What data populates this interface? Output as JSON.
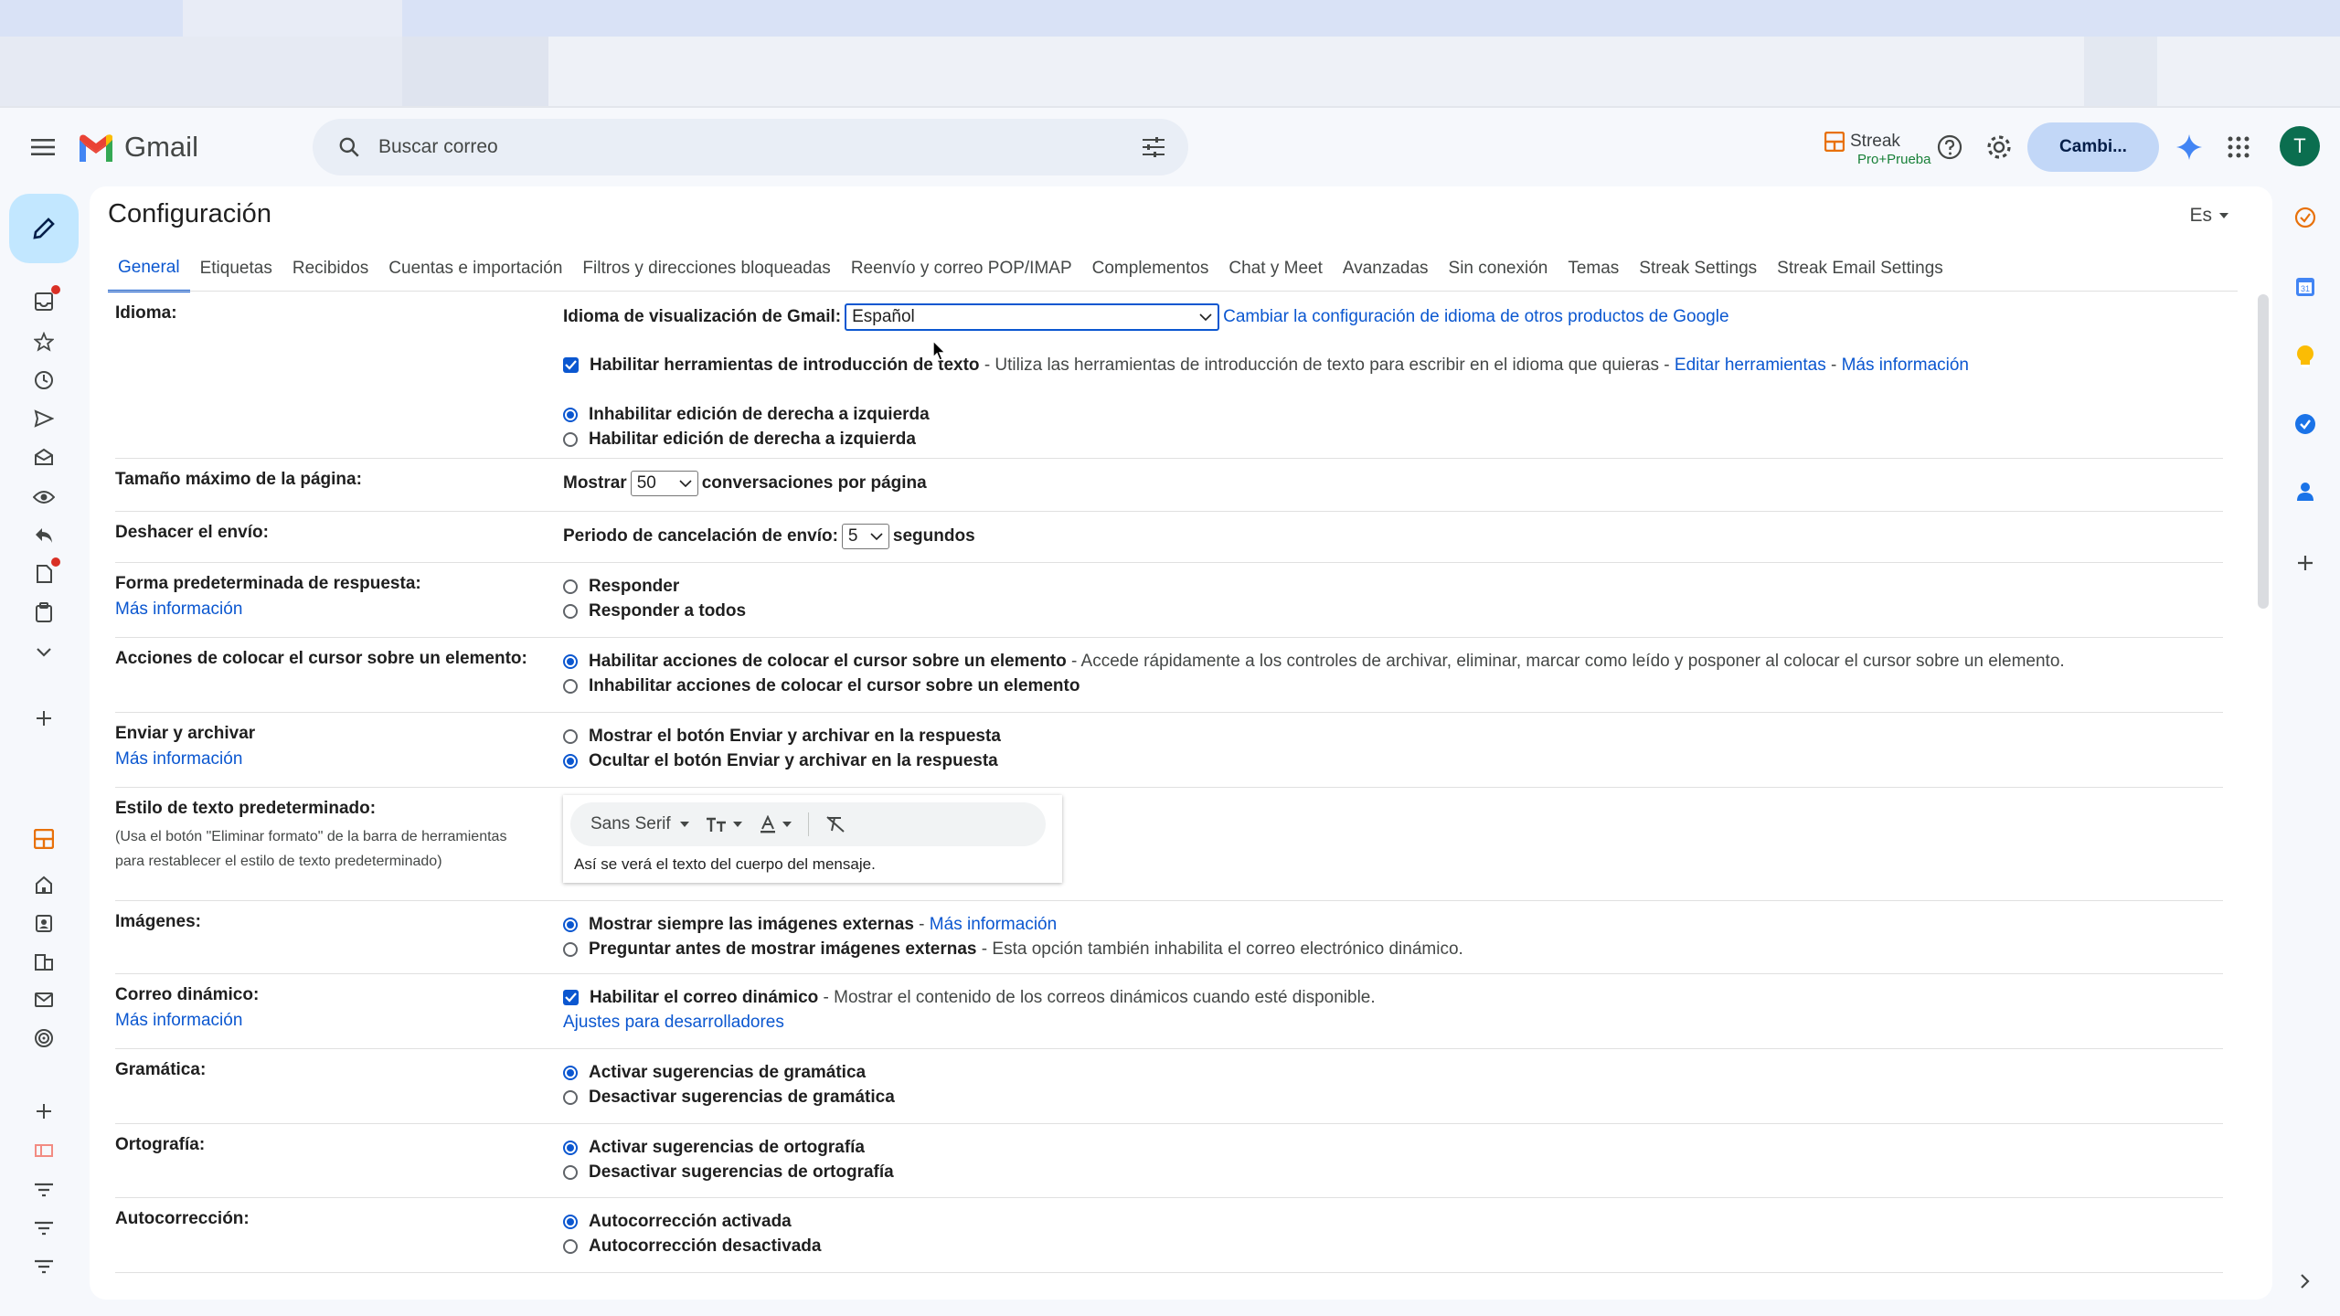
{
  "app": {
    "name": "Gmail"
  },
  "colors": {
    "accent": "#0b57d0",
    "compose_bg": "#c2e7ff",
    "avatar_bg": "#0b6e4f"
  },
  "search": {
    "placeholder": "Buscar correo"
  },
  "header": {
    "streak_label": "Streak",
    "streak_badge": "Pro+Prueba",
    "account_chip": "Cambi...",
    "avatar_letter": "T"
  },
  "page": {
    "title": "Configuración",
    "language_short": "Es"
  },
  "tabs": [
    "General",
    "Etiquetas",
    "Recibidos",
    "Cuentas e importación",
    "Filtros y direcciones bloqueadas",
    "Reenvío y correo POP/IMAP",
    "Complementos",
    "Chat y Meet",
    "Avanzadas",
    "Sin conexión",
    "Temas",
    "Streak Settings",
    "Streak Email Settings"
  ],
  "settings": {
    "idioma": {
      "label": "Idioma:",
      "display_label": "Idioma de visualización de Gmail:",
      "display_value": "Español",
      "change_link": "Cambiar la configuración de idioma de otros productos de Google",
      "input_tools_label": "Habilitar herramientas de introducción de texto",
      "input_tools_desc": " - Utiliza las herramientas de introducción de texto para escribir en el idioma que quieras - ",
      "edit_tools_link": "Editar herramientas",
      "more_info_link": "Más información",
      "rtl_on": "Inhabilitar edición de derecha a izquierda",
      "rtl_off": "Habilitar edición de derecha a izquierda"
    },
    "page_size": {
      "label": "Tamaño máximo de la página:",
      "show": "Mostrar",
      "value": "50",
      "suffix": "conversaciones por página"
    },
    "undo_send": {
      "label": "Deshacer el envío:",
      "prefix": "Periodo de cancelación de envío:",
      "value": "5",
      "suffix": "segundos"
    },
    "reply": {
      "label": "Forma predeterminada de respuesta:",
      "link": "Más información",
      "opt1": "Responder",
      "opt2": "Responder a todos"
    },
    "hover": {
      "label": "Acciones de colocar el cursor sobre un elemento:",
      "opt1": "Habilitar acciones de colocar el cursor sobre un elemento",
      "opt1_desc": " - Accede rápidamente a los controles de archivar, eliminar, marcar como leído y posponer al colocar el cursor sobre un elemento.",
      "opt2": "Inhabilitar acciones de colocar el cursor sobre un elemento"
    },
    "send_archive": {
      "label": "Enviar y archivar",
      "link": "Más información",
      "opt1": "Mostrar el botón Enviar y archivar en la respuesta",
      "opt2": "Ocultar el botón Enviar y archivar en la respuesta"
    },
    "text_style": {
      "label": "Estilo de texto predeterminado:",
      "sub": "(Usa el botón \"Eliminar formato\" de la barra de herramientas para restablecer el estilo de texto predeterminado)",
      "font": "Sans Serif",
      "preview": "Así se verá el texto del cuerpo del mensaje."
    },
    "images": {
      "label": "Imágenes:",
      "opt1": "Mostrar siempre las imágenes externas",
      "opt1_sep": " - ",
      "opt1_link": "Más información",
      "opt2": "Preguntar antes de mostrar imágenes externas",
      "opt2_desc": " - Esta opción también inhabilita el correo electrónico dinámico."
    },
    "dynamic": {
      "label": "Correo dinámico:",
      "link": "Más información",
      "opt1": "Habilitar el correo dinámico",
      "opt1_desc": " - Mostrar el contenido de los correos dinámicos cuando esté disponible.",
      "dev_link": "Ajustes para desarrolladores"
    },
    "grammar": {
      "label": "Gramática:",
      "opt1": "Activar sugerencias de gramática",
      "opt2": "Desactivar sugerencias de gramática"
    },
    "spelling": {
      "label": "Ortografía:",
      "opt1": "Activar sugerencias de ortografía",
      "opt2": "Desactivar sugerencias de ortografía"
    },
    "autocorrect": {
      "label": "Autocorrección:",
      "opt1": "Autocorrección activada",
      "opt2": "Autocorrección desactivada"
    }
  }
}
